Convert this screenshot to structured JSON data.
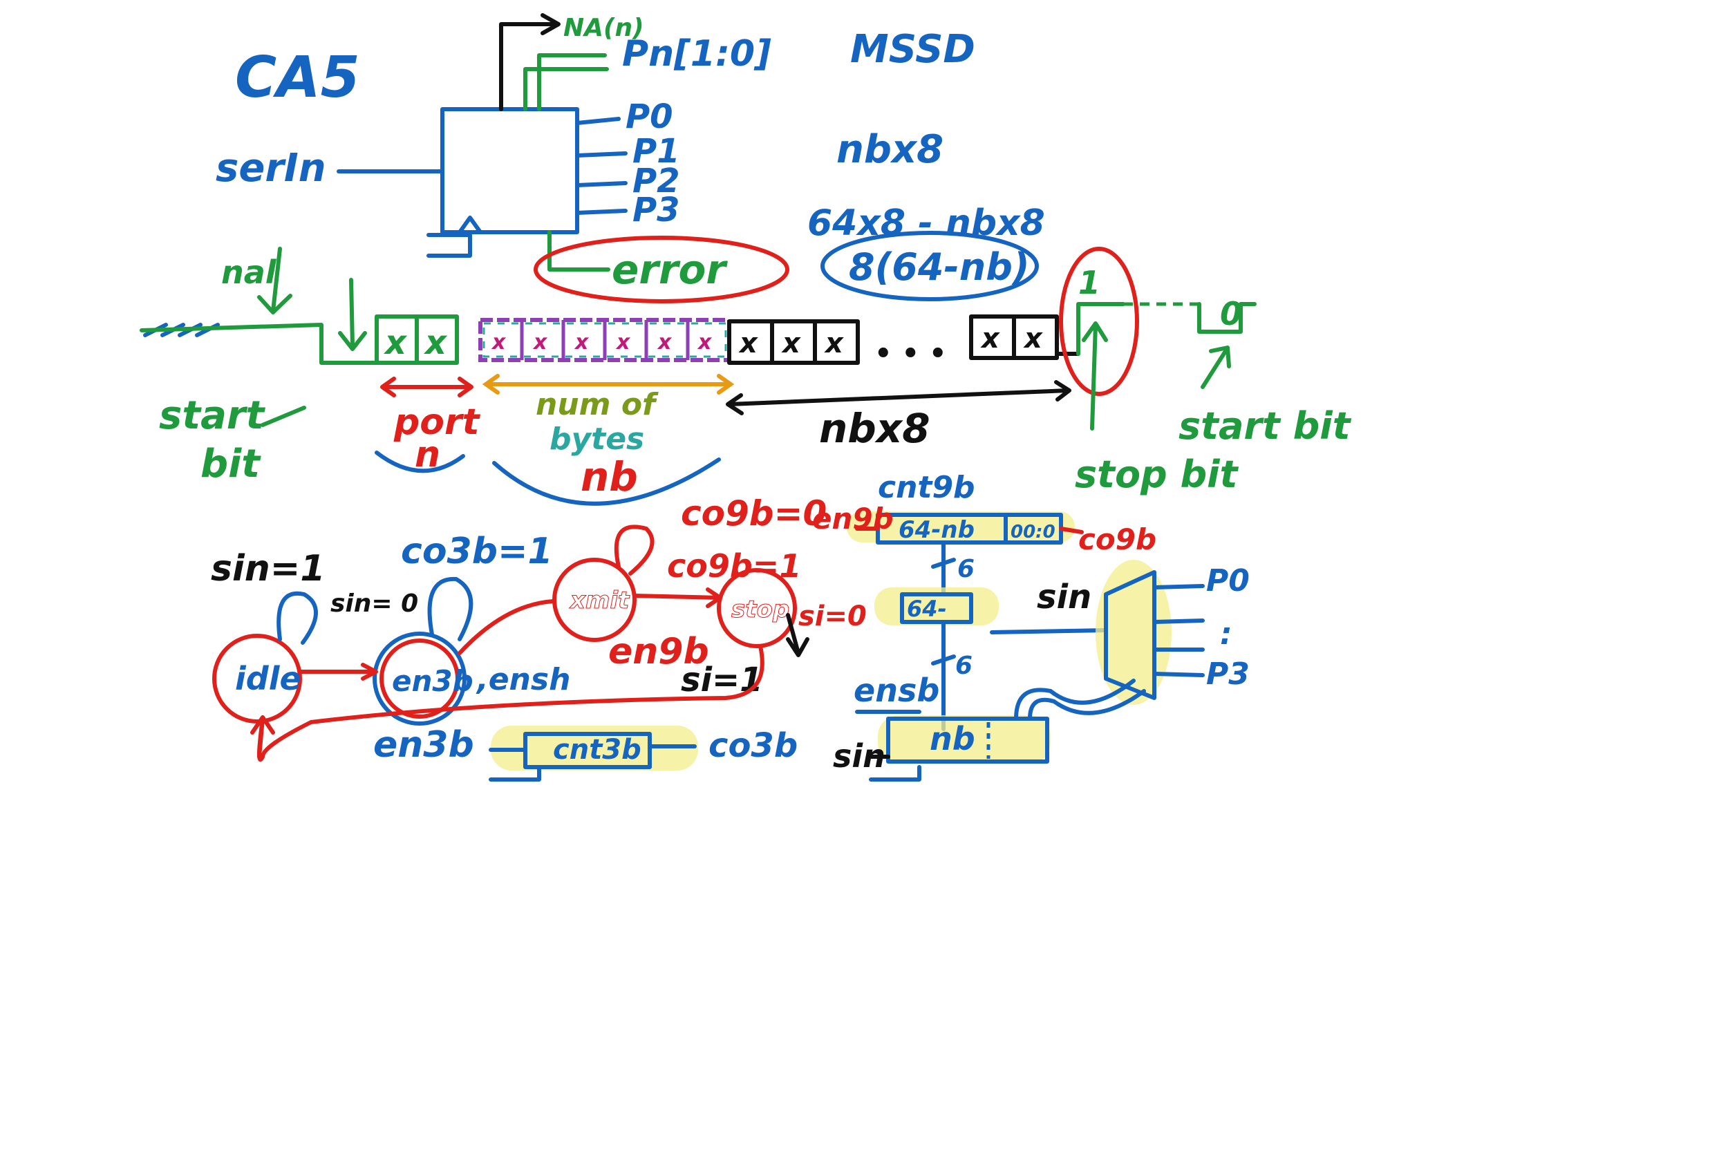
{
  "labels": {
    "title": "CA5",
    "msd": "MSSD",
    "serin": "serIn",
    "na": "NA(n)",
    "pn": "Pn[1:0]",
    "p0": "P0",
    "p1": "P1",
    "p2": "P2",
    "p3": "P3",
    "nbx8_top": "nbx8",
    "expr1": "64x8 - nbx8",
    "expr2": "8(64-nb)",
    "error": "error",
    "nal": "nal",
    "start_bit_left": "start",
    "start_bit_left2": "bit",
    "port": "port",
    "port_n": "n",
    "num_of": "num of",
    "bytes": "bytes",
    "nb": "nb",
    "nbx8_mid": "nbx8",
    "one": "1",
    "zero": "0",
    "start_bit_right": "start bit",
    "stop_bit": "stop bit",
    "x": "x",
    "dots": "• • •"
  },
  "fsm": {
    "idle": "idle",
    "en3b_state": "en3b",
    "xmit": "xmit",
    "stop": "stop",
    "sin1": "sin=1",
    "sin0": "sin= 0",
    "co3b1": "co3b=1",
    "co9b0": "co9b=0",
    "co9b1": "co9b=1",
    "en9b": "en9b",
    "si0": "si=0",
    "si1": "si=1",
    "ensh": ",ensh",
    "en3b_bottom": "en3b",
    "cnt3b": "cnt3b",
    "co3b": "co3b"
  },
  "datapath": {
    "cnt9b": "cnt9b",
    "en9b": "en9b",
    "reg_64nb": "64-nb",
    "reg_000": "00:0",
    "co9b": "co9b",
    "six_a": "6",
    "sub_64": "64-",
    "six_b": "6",
    "sin_mux": "sin",
    "ensb": "ensb",
    "nb_reg": "nb",
    "sin_bottom": "sin",
    "mux_p0": "P0",
    "mux_dots": ":",
    "mux_p3": "P3"
  }
}
